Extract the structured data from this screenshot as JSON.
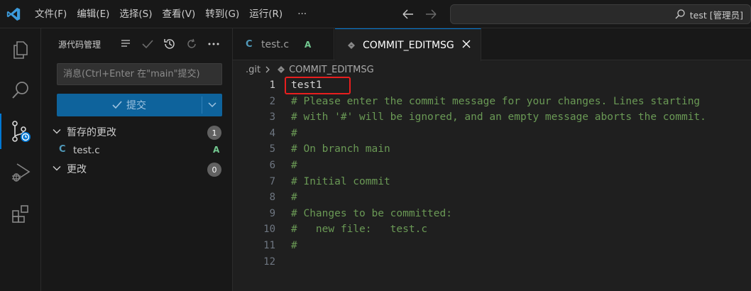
{
  "menu": [
    "文件(F)",
    "编辑(E)",
    "选择(S)",
    "查看(V)",
    "转到(G)",
    "运行(R)",
    "···"
  ],
  "search": {
    "text": "test [管理员]",
    "icon": "search-icon"
  },
  "activity": [
    "explorer-icon",
    "search-icon",
    "source-control-icon",
    "run-debug-icon",
    "extensions-icon"
  ],
  "scm": {
    "title": "源代码管理",
    "message_placeholder": "消息(Ctrl+Enter 在\"main\"提交)",
    "commit_label": "提交",
    "staged": {
      "label": "暂存的更改",
      "count": "1"
    },
    "changes": {
      "label": "更改",
      "count": "0"
    },
    "staged_file": {
      "icon": "C",
      "name": "test.c",
      "status": "A"
    }
  },
  "tabs": [
    {
      "icon": "C",
      "name": "test.c",
      "status": "A"
    },
    {
      "icon": "git-icon",
      "name": "COMMIT_EDITMSG",
      "close": "×"
    }
  ],
  "breadcrumb": [
    ".git",
    "COMMIT_EDITMSG"
  ],
  "editor": {
    "line_numbers": [
      "1",
      "2",
      "3",
      "4",
      "5",
      "6",
      "7",
      "8",
      "9",
      "10",
      "11",
      "12"
    ],
    "lines": [
      "test1",
      "# Please enter the commit message for your changes. Lines starting",
      "# with '#' will be ignored, and an empty message aborts the commit.",
      "#",
      "# On branch main",
      "#",
      "# Initial commit",
      "#",
      "# Changes to be committed:",
      "#   new file:   test.c",
      "#",
      ""
    ]
  },
  "colors": {
    "accent": "#0078d4",
    "comment": "#6a9955",
    "highlight": "#e81e1e",
    "added": "#73c991"
  }
}
